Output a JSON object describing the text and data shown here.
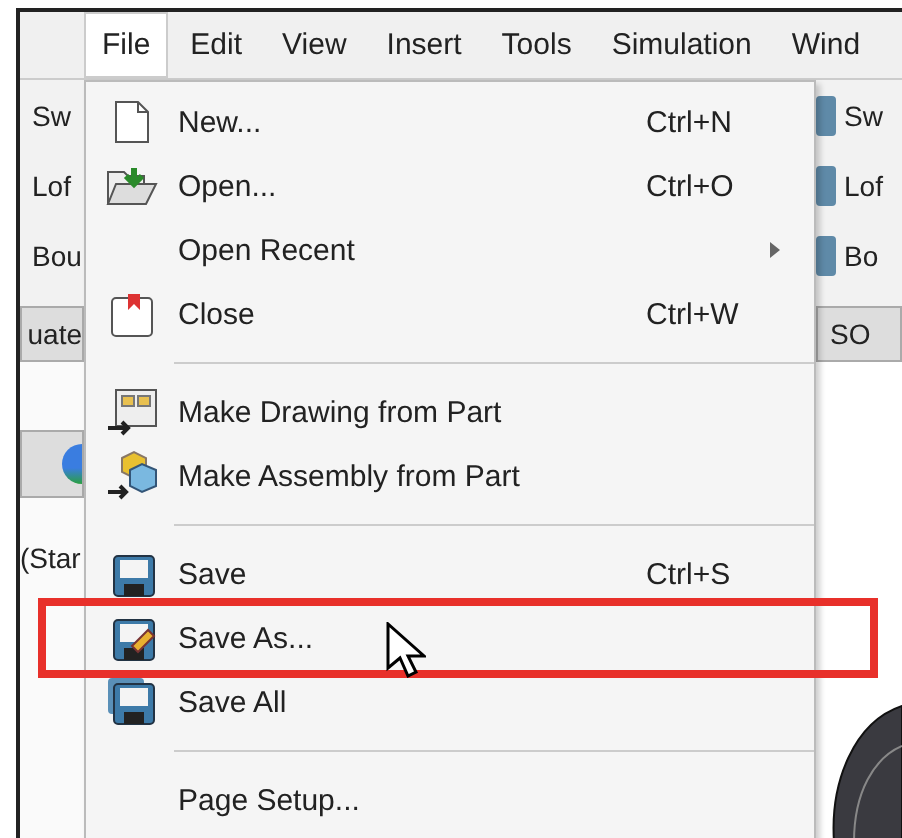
{
  "menu_bar": [
    {
      "label": "File",
      "selected": true
    },
    {
      "label": "Edit",
      "selected": false
    },
    {
      "label": "View",
      "selected": false
    },
    {
      "label": "Insert",
      "selected": false
    },
    {
      "label": "Tools",
      "selected": false
    },
    {
      "label": "Simulation",
      "selected": false
    },
    {
      "label": "Wind",
      "selected": false
    }
  ],
  "left_toolbar": [
    "Sw",
    "Lof",
    "Bou"
  ],
  "left_tab": "uate",
  "left_tree_text": "(Star",
  "right_toolbar": [
    "Sw",
    "Lof",
    "Bo"
  ],
  "right_tab": "SO",
  "file_menu": [
    {
      "kind": "item",
      "label": "New...",
      "shortcut": "Ctrl+N",
      "submenu": false,
      "annotated": false
    },
    {
      "kind": "item",
      "label": "Open...",
      "shortcut": "Ctrl+O",
      "submenu": false,
      "annotated": false
    },
    {
      "kind": "item",
      "label": "Open Recent",
      "submenu": true,
      "annotated": false
    },
    {
      "kind": "item",
      "label": "Close",
      "shortcut": "Ctrl+W",
      "submenu": false,
      "annotated": false
    },
    {
      "kind": "separator"
    },
    {
      "kind": "item",
      "label": "Make Drawing from Part",
      "submenu": false,
      "annotated": false
    },
    {
      "kind": "item",
      "label": "Make Assembly from Part",
      "submenu": false,
      "annotated": false
    },
    {
      "kind": "separator"
    },
    {
      "kind": "item",
      "label": "Save",
      "shortcut": "Ctrl+S",
      "submenu": false,
      "annotated": false
    },
    {
      "kind": "item",
      "label": "Save As...",
      "submenu": false,
      "annotated": true
    },
    {
      "kind": "item",
      "label": "Save All",
      "submenu": false,
      "annotated": false
    },
    {
      "kind": "separator"
    },
    {
      "kind": "item",
      "label": "Page Setup...",
      "submenu": false,
      "annotated": false
    }
  ]
}
